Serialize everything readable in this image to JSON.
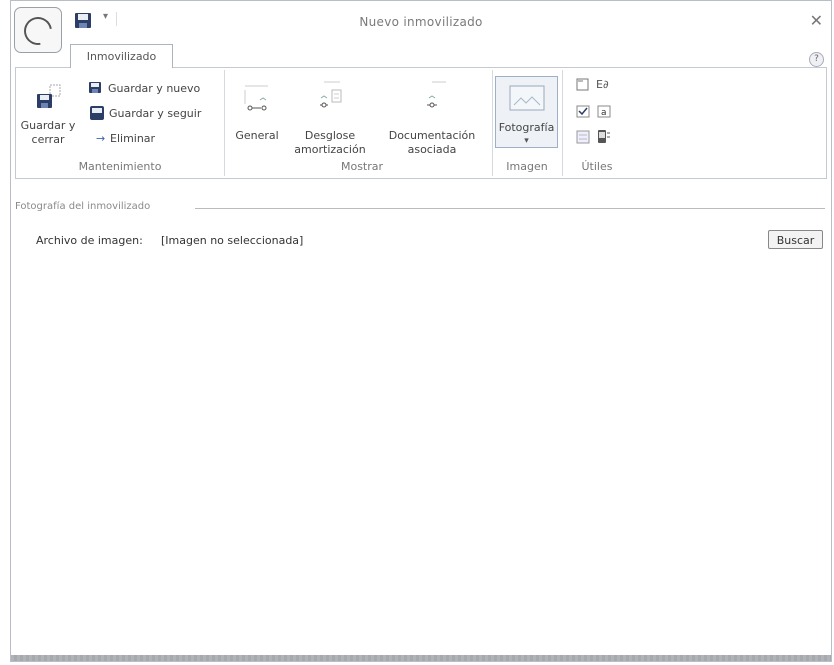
{
  "window": {
    "title": "Nuevo inmovilizado"
  },
  "tabs": [
    {
      "label": "Inmovilizado"
    }
  ],
  "ribbon": {
    "mantenimiento": {
      "label": "Mantenimiento",
      "guardar_cerrar": "Guardar y cerrar",
      "guardar_nuevo": "Guardar y nuevo",
      "guardar_seguir": "Guardar y seguir",
      "eliminar": "Eliminar"
    },
    "mostrar": {
      "label": "Mostrar",
      "general": "General",
      "desglose": "Desglose amortización",
      "documentacion": "Documentación asociada"
    },
    "imagen": {
      "label": "Imagen",
      "fotografia": "Fotografía"
    },
    "utiles": {
      "label": "Útiles"
    }
  },
  "content": {
    "section_title": "Fotografía del inmovilizado",
    "archivo_label": "Archivo de imagen:",
    "archivo_value": "[Imagen no seleccionada]",
    "buscar_button": "Buscar"
  },
  "icons": {
    "app": "app-orb-icon",
    "save": "floppy-disk-icon",
    "close": "close-icon",
    "help": "help-icon"
  }
}
